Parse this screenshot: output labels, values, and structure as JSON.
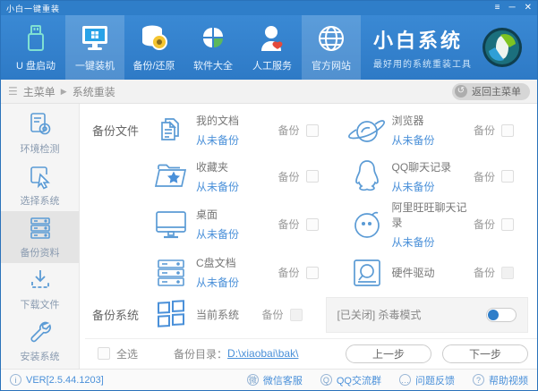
{
  "window": {
    "title": "小白一键重装",
    "menu": "≡",
    "minimize": "─",
    "close": "✕"
  },
  "nav": {
    "items": [
      {
        "label": "U 盘启动",
        "icon": "usb-drive-icon",
        "active": false
      },
      {
        "label": "一键装机",
        "icon": "monitor-install-icon",
        "active": true
      },
      {
        "label": "备份/还原",
        "icon": "database-backup-icon",
        "active": false
      },
      {
        "label": "软件大全",
        "icon": "software-clover-icon",
        "active": false
      },
      {
        "label": "人工服务",
        "icon": "support-person-icon",
        "active": false
      },
      {
        "label": "官方网站",
        "icon": "globe-icon",
        "active": true
      }
    ],
    "brand": {
      "title": "小白系统",
      "tagline": "最好用的系统重装工具"
    }
  },
  "breadcrumb": {
    "root": "主菜单",
    "separator": "▶",
    "current": "系统重装",
    "back_label": "返回主菜单",
    "back_glyph": "↺"
  },
  "sidebar": {
    "items": [
      {
        "label": "环境检测"
      },
      {
        "label": "选择系统"
      },
      {
        "label": "备份资料"
      },
      {
        "label": "下载文件"
      },
      {
        "label": "安装系统"
      }
    ]
  },
  "main": {
    "section_files": "备份文件",
    "section_system": "备份系统",
    "backup_label": "备份",
    "left_items": [
      {
        "name": "我的文档",
        "status": "从未备份"
      },
      {
        "name": "收藏夹",
        "status": "从未备份"
      },
      {
        "name": "桌面",
        "status": "从未备份"
      },
      {
        "name": "C盘文档",
        "status": "从未备份"
      },
      {
        "name": "当前系统",
        "status": ""
      }
    ],
    "right_items": [
      {
        "name": "浏览器",
        "status": "从未备份"
      },
      {
        "name": "QQ聊天记录",
        "status": "从未备份"
      },
      {
        "name": "阿里旺旺聊天记录",
        "status": "从未备份"
      },
      {
        "name": "硬件驱动",
        "status": ""
      }
    ],
    "antivirus": {
      "label": "[已关闭] 杀毒模式",
      "enabled": false
    },
    "select_all_label": "全选",
    "backup_dir_label": "备份目录：",
    "backup_dir_value": "D:\\xiaobai\\bak\\",
    "prev_label": "上一步",
    "next_label": "下一步"
  },
  "footer": {
    "version": "VER[2.5.44.1203]",
    "info_glyph": "i",
    "links": [
      {
        "label": "微信客服",
        "glyph": "微"
      },
      {
        "label": "QQ交流群",
        "glyph": "Q"
      },
      {
        "label": "问题反馈",
        "glyph": "…"
      },
      {
        "label": "帮助视频",
        "glyph": "?"
      }
    ]
  }
}
